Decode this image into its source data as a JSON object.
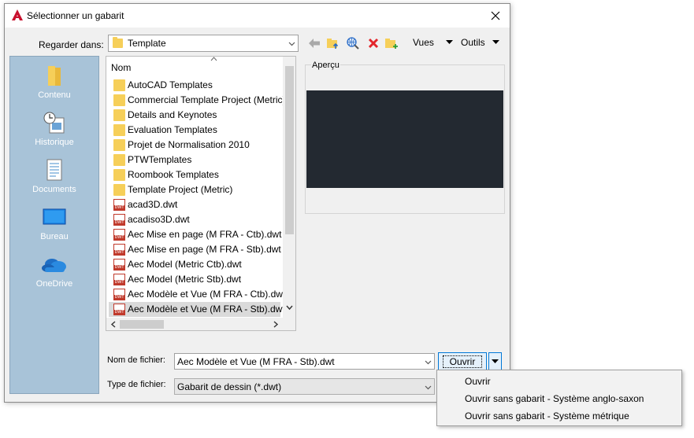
{
  "window": {
    "title": "Sélectionner un gabarit"
  },
  "toolbar": {
    "lookin_label": "Regarder dans:",
    "lookin_value": "Template",
    "views_label": "Vues",
    "tools_label": "Outils"
  },
  "places": [
    {
      "label": "Contenu",
      "icon": "folder-icon"
    },
    {
      "label": "Historique",
      "icon": "history-icon"
    },
    {
      "label": "Documents",
      "icon": "documents-icon"
    },
    {
      "label": "Bureau",
      "icon": "desktop-icon"
    },
    {
      "label": "OneDrive",
      "icon": "cloud-icon"
    }
  ],
  "filelist": {
    "column_header": "Nom",
    "items": [
      {
        "name": "AutoCAD Templates",
        "kind": "folder"
      },
      {
        "name": "Commercial Template Project (Metric)",
        "kind": "folder"
      },
      {
        "name": "Details and Keynotes",
        "kind": "folder"
      },
      {
        "name": "Evaluation Templates",
        "kind": "folder"
      },
      {
        "name": "Projet de Normalisation 2010",
        "kind": "folder"
      },
      {
        "name": "PTWTemplates",
        "kind": "folder"
      },
      {
        "name": "Roombook Templates",
        "kind": "folder"
      },
      {
        "name": "Template Project (Metric)",
        "kind": "folder"
      },
      {
        "name": "acad3D.dwt",
        "kind": "dwt"
      },
      {
        "name": "acadiso3D.dwt",
        "kind": "dwt"
      },
      {
        "name": "Aec Mise en page (M FRA - Ctb).dwt",
        "kind": "dwt"
      },
      {
        "name": "Aec Mise en page (M FRA - Stb).dwt",
        "kind": "dwt"
      },
      {
        "name": "Aec Model (Metric Ctb).dwt",
        "kind": "dwt"
      },
      {
        "name": "Aec Model (Metric Stb).dwt",
        "kind": "dwt"
      },
      {
        "name": "Aec Modèle et Vue (M FRA - Ctb).dwt",
        "kind": "dwt"
      },
      {
        "name": "Aec Modèle et Vue (M FRA - Stb).dwt",
        "kind": "dwt",
        "selected": true
      }
    ]
  },
  "preview": {
    "label": "Aperçu"
  },
  "form": {
    "filename_label": "Nom de fichier:",
    "filename_value": "Aec Modèle et Vue (M FRA - Stb).dwt",
    "filetype_label": "Type de fichier:",
    "filetype_value": "Gabarit de dessin (*.dwt)"
  },
  "buttons": {
    "open": "Ouvrir"
  },
  "open_menu": [
    "Ouvrir",
    "Ouvrir sans gabarit - Système anglo-saxon",
    "Ouvrir sans gabarit - Système métrique"
  ],
  "colors": {
    "accent": "#0078d7",
    "places_bg": "#a8c3d8",
    "preview_bg": "#232931"
  }
}
